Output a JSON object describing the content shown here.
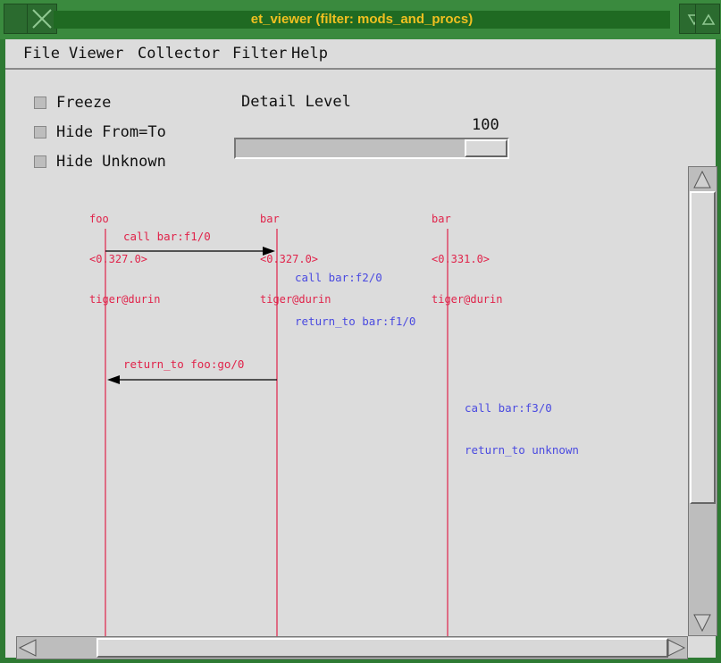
{
  "window": {
    "title": "et_viewer (filter: mods_and_procs)"
  },
  "menu": {
    "items": [
      "File",
      "Viewer",
      "Collector",
      "Filter",
      "Help"
    ]
  },
  "options": {
    "freeze": "Freeze",
    "hide_from_to": "Hide From=To",
    "hide_unknown": "Hide Unknown"
  },
  "detail": {
    "label": "Detail Level",
    "value": "100"
  },
  "colors": {
    "process": "#e0234a",
    "event": "#4a4ae0",
    "arrow": "#000000",
    "title_text": "#f0c020"
  },
  "processes": [
    {
      "name": "foo",
      "pid": "<0.327.0>",
      "node": "tiger@durin"
    },
    {
      "name": "bar",
      "pid": "<0.327.0>",
      "node": "tiger@durin"
    },
    {
      "name": "bar",
      "pid": "<0.331.0>",
      "node": "tiger@durin"
    }
  ],
  "events": [
    {
      "label": "call bar:f1/0",
      "kind": "message",
      "from": 0,
      "to": 1
    },
    {
      "label": "call bar:f2/0",
      "kind": "local",
      "on": 1
    },
    {
      "label": "return_to bar:f1/0",
      "kind": "local",
      "on": 1
    },
    {
      "label": "return_to foo:go/0",
      "kind": "message",
      "from": 1,
      "to": 0
    },
    {
      "label": "call bar:f3/0",
      "kind": "local",
      "on": 2
    },
    {
      "label": "return_to unknown",
      "kind": "local",
      "on": 2
    }
  ]
}
